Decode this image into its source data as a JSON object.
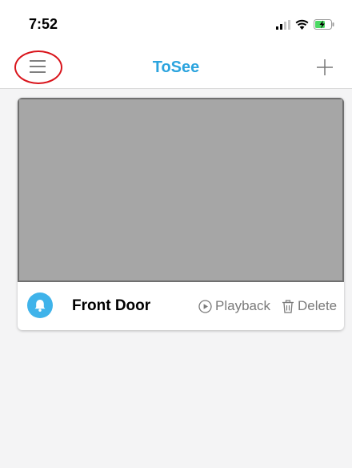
{
  "status_bar": {
    "time": "7:52",
    "icons": [
      "signal-icon",
      "wifi-icon",
      "battery-charging-icon"
    ]
  },
  "nav": {
    "title": "ToSee",
    "menu_icon": "hamburger-menu-icon",
    "add_icon": "plus-icon"
  },
  "colors": {
    "accent": "#2ca4de",
    "highlight_ring": "#d9141b",
    "preview_placeholder": "#a6a6a6"
  },
  "camera": {
    "name": "Front Door",
    "icon": "bell-icon",
    "playback_label": "Playback",
    "delete_label": "Delete"
  }
}
